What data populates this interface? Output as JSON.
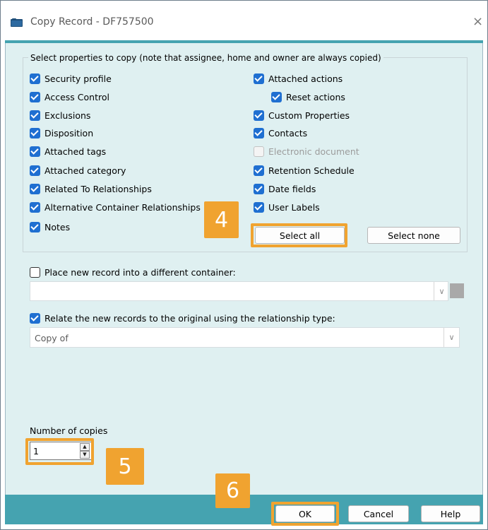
{
  "window": {
    "title": "Copy Record - DF757500",
    "close_glyph": "×",
    "icon": "folder-icon"
  },
  "group": {
    "legend": "Select properties to copy (note that assignee, home and owner are always copied)",
    "left_items": [
      {
        "label": "Security profile",
        "checked": true
      },
      {
        "label": "Access Control",
        "checked": true
      },
      {
        "label": "Exclusions",
        "checked": true
      },
      {
        "label": "Disposition",
        "checked": true
      },
      {
        "label": "Attached tags",
        "checked": true
      },
      {
        "label": "Attached category",
        "checked": true
      },
      {
        "label": "Related To Relationships",
        "checked": true
      },
      {
        "label": "Alternative Container Relationships",
        "checked": true
      },
      {
        "label": "Notes",
        "checked": true
      }
    ],
    "right_items": [
      {
        "label": "Attached actions",
        "checked": true
      },
      {
        "label": "Reset actions",
        "checked": true
      },
      {
        "label": "Custom Properties",
        "checked": true
      },
      {
        "label": "Contacts",
        "checked": true
      },
      {
        "label": "Electronic document",
        "checked": false,
        "disabled": true
      },
      {
        "label": "Retention Schedule",
        "checked": true
      },
      {
        "label": "Date fields",
        "checked": true
      },
      {
        "label": "User Labels",
        "checked": true
      }
    ],
    "select_all": "Select all",
    "select_none": "Select none"
  },
  "container": {
    "label": "Place new record into a different container:",
    "checked": false,
    "value": ""
  },
  "relate": {
    "label": "Relate the new records to the original using the relationship type:",
    "checked": true,
    "value": "Copy of"
  },
  "copies": {
    "label": "Number of copies",
    "value": "1"
  },
  "footer": {
    "ok": "OK",
    "cancel": "Cancel",
    "help": "Help"
  },
  "annotations": {
    "badge_4": "4",
    "badge_5": "5",
    "badge_6": "6"
  },
  "colors": {
    "accent_teal": "#45a3b0",
    "highlight_orange": "#f0a330",
    "checkbox_blue": "#1f6fd1",
    "client_bg": "#dff0f1"
  }
}
